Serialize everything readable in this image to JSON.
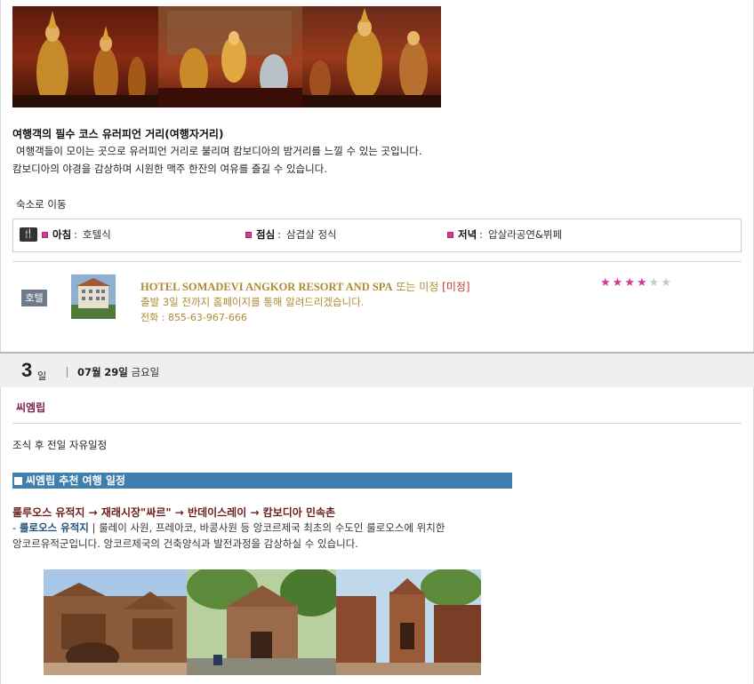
{
  "top_photos": {
    "icons": [
      "apsara-dance-photo-1",
      "apsara-dance-photo-2",
      "apsara-dance-photo-3"
    ]
  },
  "pub_street": {
    "title": "여행객의 필수 코스 유러피언 거리(여행자거리)",
    "line1": "여행객들이 모이는 곳으로 유러피언 거리로 불리며 캄보디아의 밤거리를 느낄 수 있는 곳입니다.",
    "line2": "캄보디아의 야경을 감상하며 시원한 맥주 한잔의 여유를 즐길 수 있습니다."
  },
  "move_to_hotel": "숙소로 이동",
  "meals": {
    "breakfast_label": "아침",
    "breakfast_value": "호텔식",
    "lunch_label": "점심",
    "lunch_value": "삼겹살 정식",
    "dinner_label": "저녁",
    "dinner_value": "압살라공연&뷔페"
  },
  "hotel": {
    "badge": "호텔",
    "name": "HOTEL SOMADEVI ANGKOR RESORT AND SPA",
    "or_undecided": "또는 미정",
    "undecided_tag": "[미정]",
    "notice": "출발 3일 전까지 홈페이지를 통해 알려드리겠습니다.",
    "phone": "전화 : 855-63-967-666",
    "rating": 4,
    "rating_max": 6
  },
  "day": {
    "number": "3",
    "unit": "일",
    "month": "07월",
    "date": "29일",
    "weekday": "금요일"
  },
  "city": "씨엠립",
  "schedule_note": "조식 후 전일 자유일정",
  "recommend_bar": "씨엠립 추천 여행 일정",
  "route": "룰루오스 유적지 → 재래시장\"싸르\" → 반데이스레이 → 캄보디아 민속촌",
  "roluos": {
    "prefix": "- ",
    "name": "룰로오스 유적지",
    "line1_rest": " | 룰레이 사원, 프레아코, 바콩사원 등 앙코르제국 최초의 수도인 룰로오스에 위치한",
    "line2": "앙코르유적군입니다. 앙코르제국의 건축양식과 발전과정을 감상하실 수 있습니다."
  },
  "colors": {
    "accent_pink": "#d23b8f",
    "hotel_gold": "#b08a2f",
    "bar_blue": "#3f7fb0",
    "city_maroon": "#7a1f4a"
  }
}
